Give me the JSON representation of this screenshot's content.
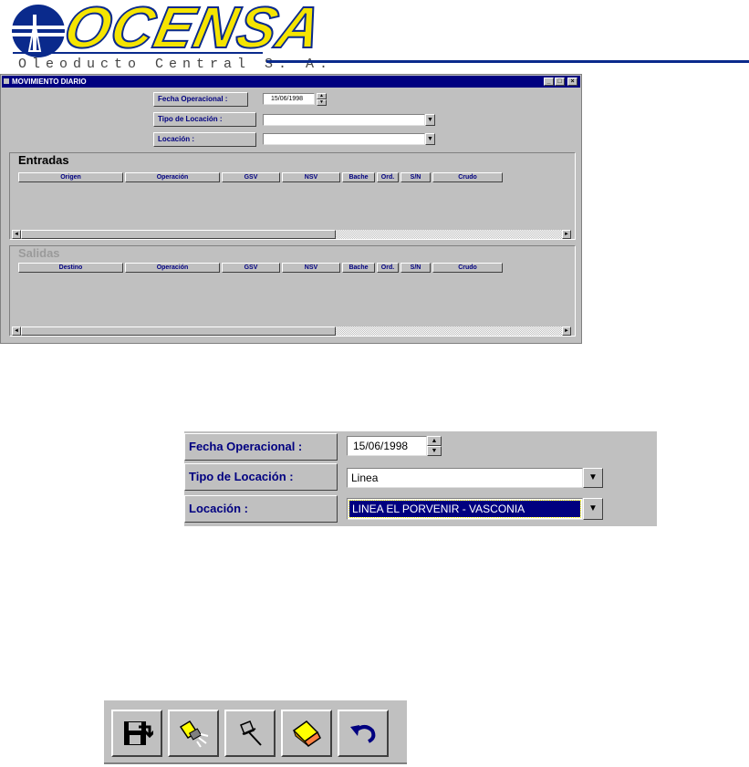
{
  "logo": {
    "brand": "OCENSA",
    "subtitle": "Oleoducto Central S. A."
  },
  "window": {
    "title": "MOVIMIENTO DIARIO",
    "controls": {
      "minimize": "_",
      "maximize": "□",
      "close": "×"
    },
    "form": {
      "fecha_label": "Fecha Operacional :",
      "fecha_value": "15/06/1998",
      "tipo_label": "Tipo de Locación :",
      "tipo_value": "",
      "locacion_label": "Locación :",
      "locacion_value": ""
    },
    "entradas": {
      "title": "Entradas",
      "columns": [
        "Origen",
        "Operación",
        "GSV",
        "NSV",
        "Bache",
        "Ord.",
        "S/N",
        "Crudo"
      ]
    },
    "salidas": {
      "title": "Salidas",
      "columns": [
        "Destino",
        "Operación",
        "GSV",
        "NSV",
        "Bache",
        "Ord.",
        "S/N",
        "Crudo"
      ]
    }
  },
  "zoom": {
    "fecha_label": "Fecha Operacional :",
    "fecha_value": "15/06/1998",
    "tipo_label": "Tipo de Locación :",
    "tipo_value": "Linea",
    "locacion_label": "Locación :",
    "locacion_value": "LINEA  EL PORVENIR - VASCONIA"
  },
  "toolbar": {
    "icons": [
      "save-icon",
      "flashlight-icon",
      "pushpin-icon",
      "eraser-icon",
      "undo-icon"
    ]
  },
  "colors": {
    "titlebar": "#000080",
    "label_text": "#000080",
    "face": "#c0c0c0",
    "logo_yellow": "#f5e400",
    "logo_blue": "#0a2a8c",
    "selection": "#000080"
  }
}
